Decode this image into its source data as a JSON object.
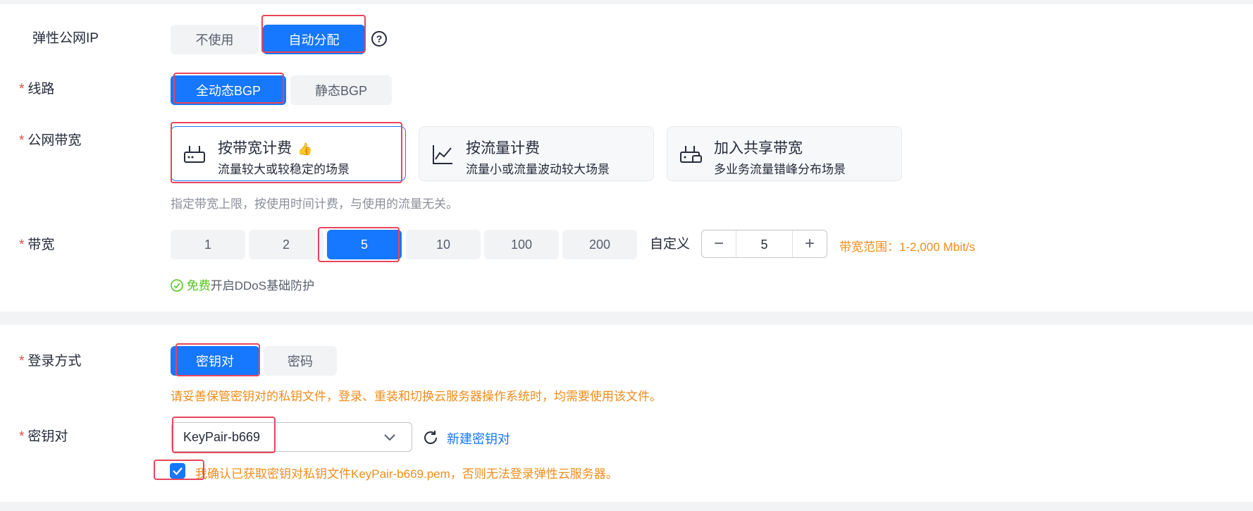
{
  "network": {
    "eip": {
      "label": "弹性公网IP",
      "options": [
        "不使用",
        "自动分配"
      ],
      "selected": "自动分配"
    },
    "line": {
      "label": "线路",
      "options": [
        "全动态BGP",
        "静态BGP"
      ],
      "selected": "全动态BGP"
    },
    "billing": {
      "label": "公网带宽",
      "cards": [
        {
          "title": "按带宽计费",
          "desc": "流量较大或较稳定的场景",
          "icon": "router-icon",
          "recommended": true
        },
        {
          "title": "按流量计费",
          "desc": "流量小或流量波动较大场景",
          "icon": "line-chart-icon",
          "recommended": false
        },
        {
          "title": "加入共享带宽",
          "desc": "多业务流量错峰分布场景",
          "icon": "shared-router-icon",
          "recommended": false
        }
      ],
      "selected": "按带宽计费",
      "hint": "指定带宽上限，按使用时间计费，与使用的流量无关。"
    },
    "bandwidth": {
      "label": "带宽",
      "options": [
        "1",
        "2",
        "5",
        "10",
        "100",
        "200"
      ],
      "selected": "5",
      "custom_label": "自定义",
      "custom_value": "5",
      "range": "带宽范围：1-2,000 Mbit/s",
      "ddos_free": "免费",
      "ddos_text": "开启DDoS基础防护"
    }
  },
  "login": {
    "method": {
      "label": "登录方式",
      "options": [
        "密钥对",
        "密码"
      ],
      "selected": "密钥对",
      "hint": "请妥善保管密钥对的私钥文件，登录、重装和切换云服务器操作系统时，均需要使用该文件。"
    },
    "keypair": {
      "label": "密钥对",
      "value": "KeyPair-b669",
      "create_link": "新建密钥对",
      "confirm_checked": true,
      "confirm_text": "我确认已获取密钥对私钥文件KeyPair-b669.pem，否则无法登录弹性云服务器。"
    }
  },
  "colors": {
    "primary": "#1677ff",
    "warning": "#f08c1a",
    "success": "#52c41a",
    "required": "#e94b4b",
    "highlight": "#e8455b"
  }
}
